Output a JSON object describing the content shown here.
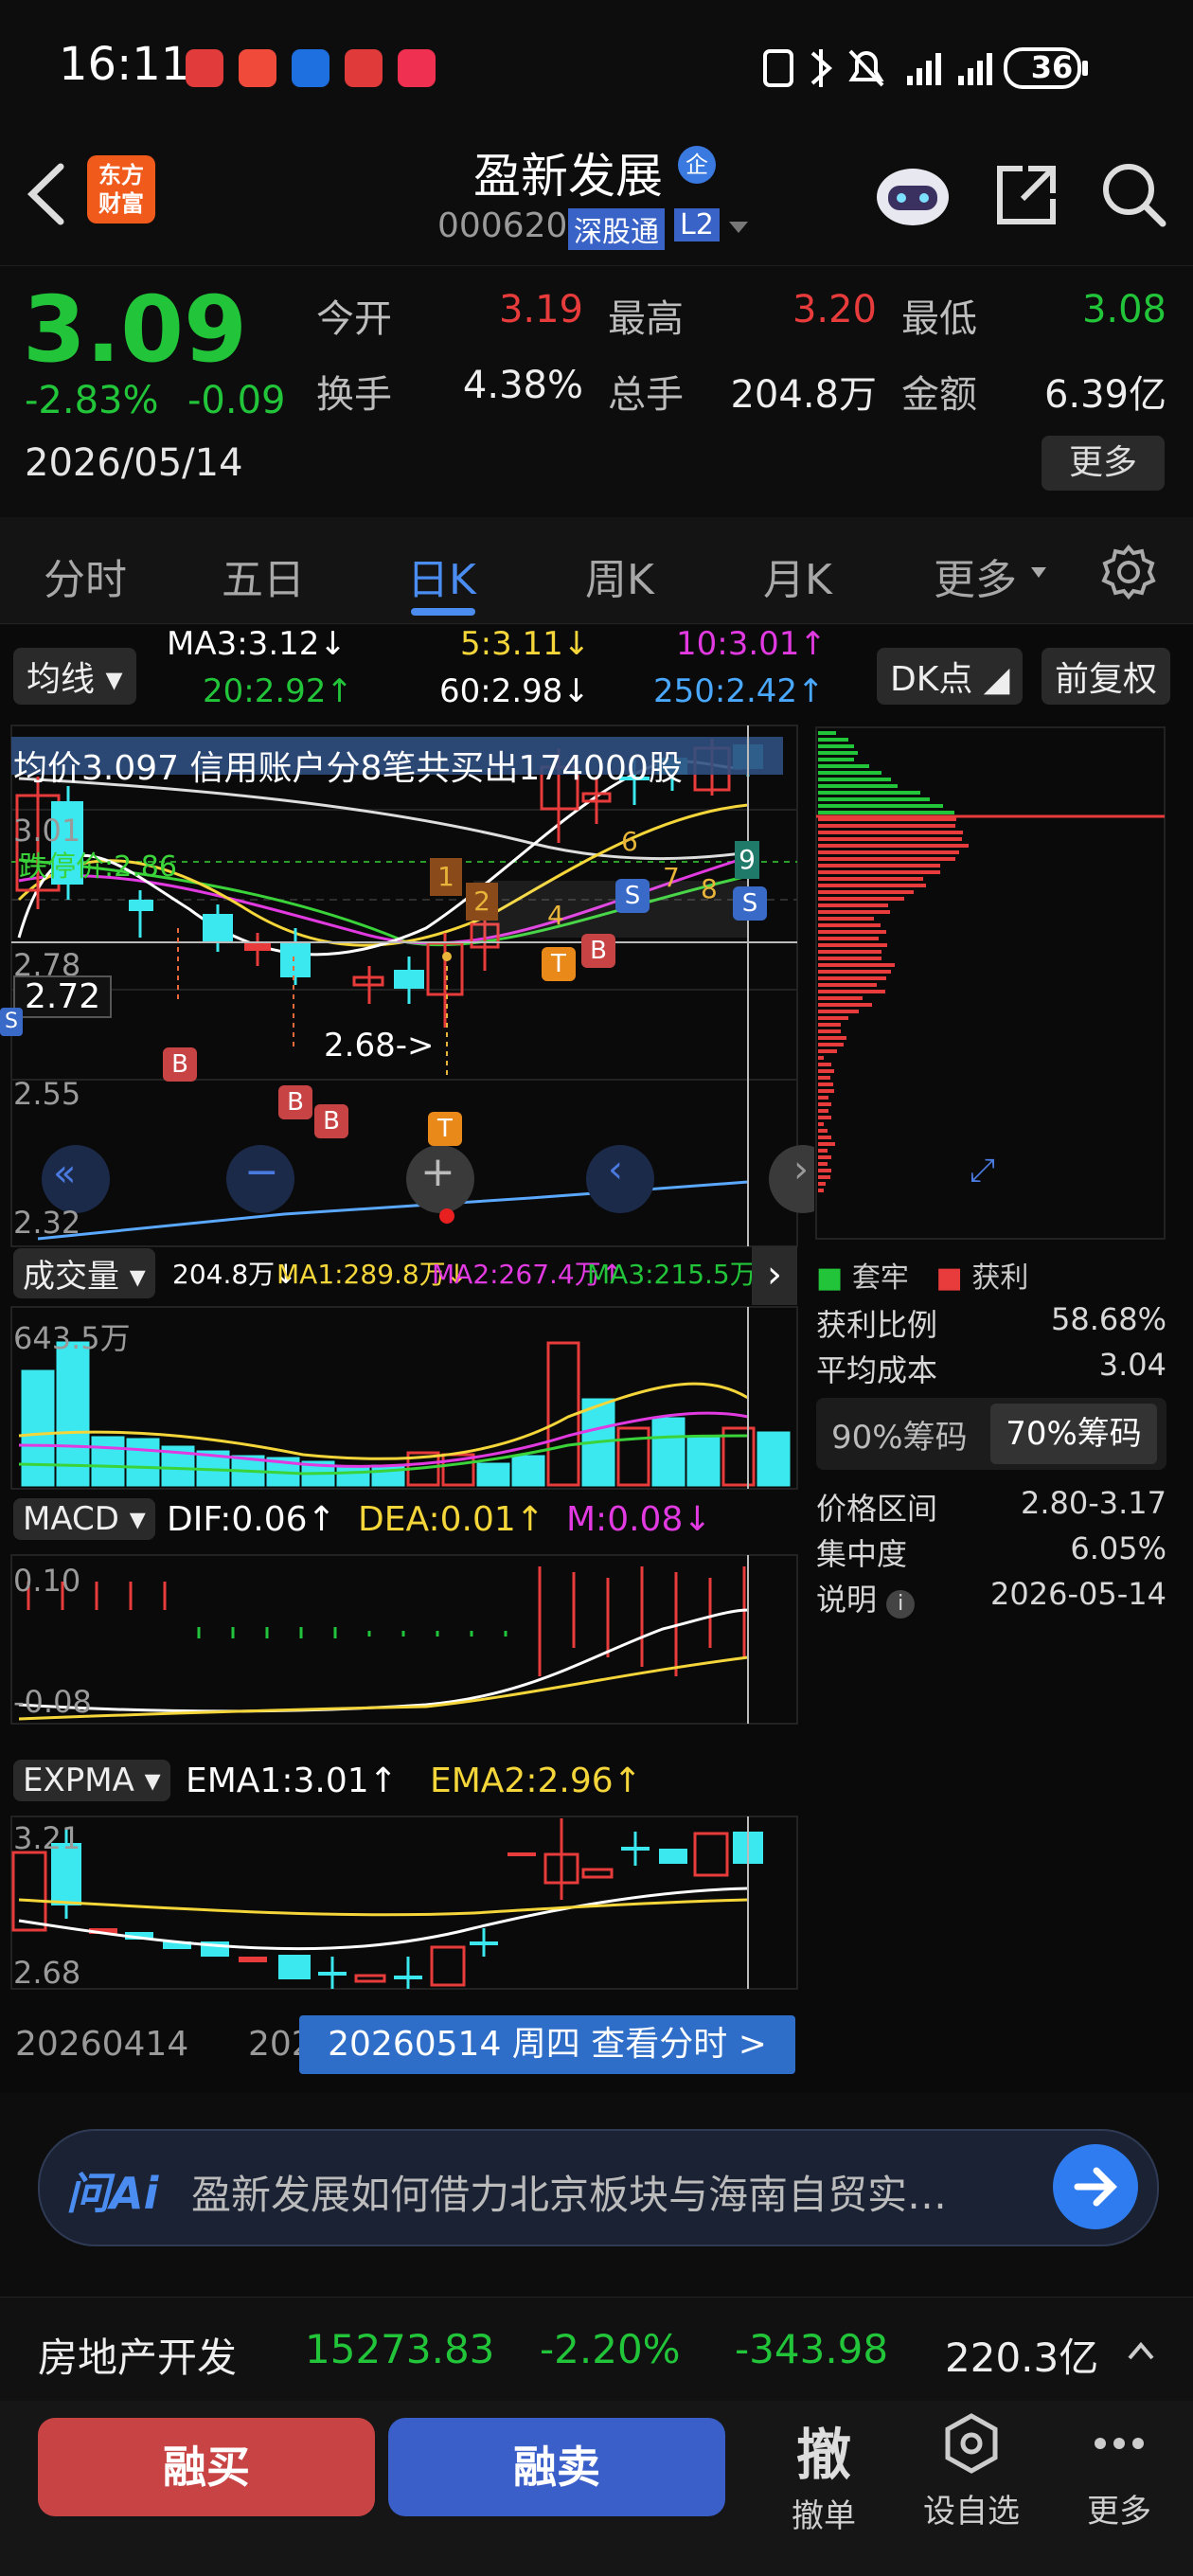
{
  "status_bar": {
    "time": "16:11",
    "battery": "36"
  },
  "header": {
    "stock_name": "盈新发展",
    "enterprise_badge": "企",
    "code": "000620",
    "connect_tag": "深股通",
    "level_tag": "L2",
    "app_logo_line1": "东方",
    "app_logo_line2": "财富"
  },
  "quote": {
    "price": "3.09",
    "change_pct": "-2.83%",
    "change": "-0.09",
    "date": "2026/05/14",
    "open_label": "今开",
    "open": "3.19",
    "high_label": "最高",
    "high": "3.20",
    "low_label": "最低",
    "low": "3.08",
    "turnover_label": "换手",
    "turnover": "4.38%",
    "volume_label": "总手",
    "volume": "204.8万",
    "amount_label": "金额",
    "amount": "6.39亿",
    "more_label": "更多"
  },
  "tabs": [
    "分时",
    "五日",
    "日K",
    "周K",
    "月K",
    "更多"
  ],
  "active_tab": "日K",
  "ma_bar": {
    "selector": "均线",
    "ma3": "MA3:3.12",
    "ma5": "5:3.11",
    "ma10": "10:3.01",
    "ma20": "20:2.92",
    "ma60": "60:2.98",
    "ma250": "250:2.42",
    "dk_label": "DK点",
    "adjust_label": "前复权"
  },
  "kline": {
    "banner": "均价3.097  信用账户分8笔共买出174000股",
    "price_3_01": "3.01",
    "price_2_78": "2.78",
    "price_2_55": "2.55",
    "price_2_32": "2.32",
    "cursor_price": "2.72",
    "limit_down": "跌停价:2.86",
    "low_marker": "2.68->",
    "marks": [
      "B",
      "B",
      "B",
      "T",
      "T",
      "B",
      "S",
      "S",
      "S",
      "1",
      "2",
      "4",
      "6",
      "7",
      "8",
      "9"
    ]
  },
  "volume_bar": {
    "selector": "成交量",
    "vol": "204.8万",
    "ma1": "MA1:289.8万",
    "ma2": "MA2:267.4万",
    "ma3": "MA3:215.5万",
    "max": "643.5万"
  },
  "macd_bar": {
    "selector": "MACD",
    "dif": "DIF:0.06",
    "dea": "DEA:0.01",
    "m": "M:0.08",
    "top": "0.10",
    "bottom": "-0.08"
  },
  "expma_bar": {
    "selector": "EXPMA",
    "ema1": "EMA1:3.01",
    "ema2": "EMA2:2.96",
    "top": "3.21",
    "bottom": "2.68"
  },
  "dates": {
    "start": "20260414",
    "partial": "202",
    "tooltip": "20260514 周四 查看分时 >"
  },
  "chip_panel": {
    "legend_trapped": "套牢",
    "legend_profit": "获利",
    "profit_ratio_label": "获利比例",
    "profit_ratio": "58.68%",
    "avg_cost_label": "平均成本",
    "avg_cost": "3.04",
    "tab90": "90%筹码",
    "tab70": "70%筹码",
    "range_label": "价格区间",
    "range": "2.80-3.17",
    "concentration_label": "集中度",
    "concentration": "6.05%",
    "note_label": "说明",
    "note_date": "2026-05-14"
  },
  "ai": {
    "logo": "问Ai",
    "prompt": "盈新发展如何借力北京板块与海南自贸实…"
  },
  "sector": {
    "name": "房地产开发",
    "index": "15273.83",
    "pct": "-2.20%",
    "change": "-343.98",
    "amount": "220.3亿"
  },
  "bottom": {
    "buy": "融买",
    "sell": "融卖",
    "cancel_icon": "撤",
    "cancel": "撤单",
    "watch": "设自选",
    "more": "更多"
  },
  "colors": {
    "up": "#e83b3b",
    "down": "#22c43a",
    "accent_blue": "#3a5fc9",
    "buy_red": "#c84444"
  }
}
